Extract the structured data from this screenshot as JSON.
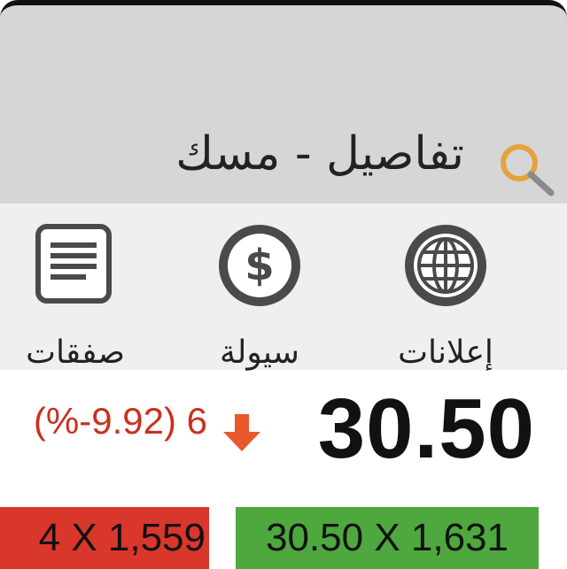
{
  "header": {
    "title": "تفاصيل - مسك",
    "search_icon": "search-icon"
  },
  "toolbar": {
    "items": [
      {
        "label": "إعلانات",
        "icon": "globe-icon"
      },
      {
        "label": "سيولة",
        "icon": "dollar-icon"
      },
      {
        "label": "صفقات",
        "icon": "document-icon"
      }
    ]
  },
  "quote": {
    "price": "30.50",
    "change": "(%-9.92) 6",
    "direction": "down",
    "bid": "30.50 X 1,631",
    "ask": "4 X 1,559"
  },
  "colors": {
    "header_bg": "#d6d6d6",
    "toolbar_bg": "#efefef",
    "down": "#c8311f",
    "arrow": "#e8582b",
    "bid_bg": "#4ea83d",
    "ask_bg": "#d9362c",
    "icon_dark": "#4a4a4a",
    "search_accent": "#e6a23c"
  }
}
